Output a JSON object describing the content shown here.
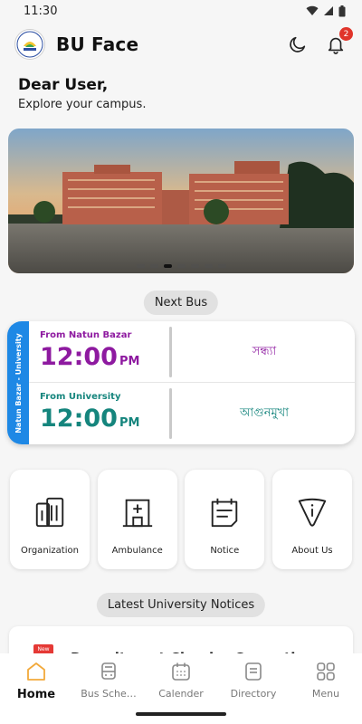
{
  "status": {
    "time": "11:30"
  },
  "app": {
    "title": "BU Face",
    "notification_count": "2"
  },
  "greeting": {
    "title": "Dear User,",
    "subtitle": "Explore your campus."
  },
  "carousel": {
    "slide_count": 7,
    "active_index": 2
  },
  "next_bus": {
    "label": "Next Bus",
    "route_tag": "Natun Bazar - University",
    "rows": [
      {
        "from": "From Natun Bazar",
        "time": "12:00",
        "ampm": "PM",
        "bus": "সন্ধ্যা",
        "color": "#8e1aa0"
      },
      {
        "from": "From University",
        "time": "12:00",
        "ampm": "PM",
        "bus": "আগুনমুখা",
        "color": "#15857d"
      }
    ]
  },
  "tiles": [
    {
      "label": "Organization",
      "icon": "building-icon"
    },
    {
      "label": "Ambulance",
      "icon": "hospital-icon"
    },
    {
      "label": "Notice",
      "icon": "calendar-notice-icon"
    },
    {
      "label": "About Us",
      "icon": "info-triangle-icon"
    }
  ],
  "notices": {
    "label": "Latest University Notices",
    "tag": "New",
    "first_title": "Recruitment Circular Correction"
  },
  "nav": [
    {
      "label": "Home",
      "icon": "home-icon",
      "active": true
    },
    {
      "label": "Bus Sche…",
      "icon": "bus-icon",
      "active": false
    },
    {
      "label": "Calender",
      "icon": "calendar-icon",
      "active": false
    },
    {
      "label": "Directory",
      "icon": "directory-icon",
      "active": false
    },
    {
      "label": "Menu",
      "icon": "grid-icon",
      "active": false
    }
  ],
  "colors": {
    "accent_blue": "#1e88e5",
    "active_nav": "#f2a93b",
    "badge": "#e0342a"
  }
}
